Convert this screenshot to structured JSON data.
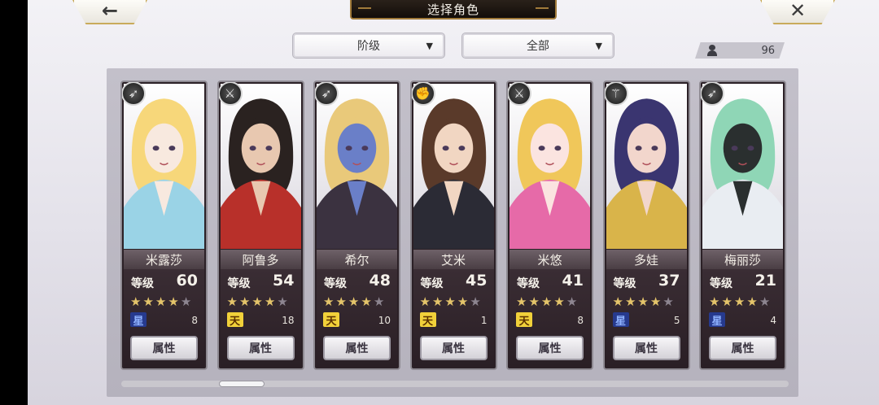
{
  "header": {
    "title": "选择角色",
    "back_icon": "back-arrow-icon",
    "close_icon": "close-x-icon"
  },
  "filters": {
    "rank": {
      "label": "阶级"
    },
    "category": {
      "label": "全部"
    }
  },
  "character_count": "96",
  "colors": {
    "gold_border": "#c9ab5b",
    "title_bg": "#1c1510",
    "star_on": "#e4c46a",
    "star_off": "#8d8590",
    "star_rank_badge": "#263a8e",
    "heaven_rank_badge": "#f1d13a"
  },
  "cards": [
    {
      "name": "米露莎",
      "level_label": "等级",
      "level": "60",
      "stars_on": 4,
      "stars_total": 5,
      "rank_icon": "星",
      "rank_type": "star",
      "sub_value": "8",
      "attr_label": "属性",
      "weapon_icon": "bow-icon",
      "palette": [
        "#f7d77a",
        "#9ad3e6",
        "#f8e9df"
      ]
    },
    {
      "name": "阿鲁多",
      "level_label": "等级",
      "level": "54",
      "stars_on": 4,
      "stars_total": 5,
      "rank_icon": "天",
      "rank_type": "heaven",
      "sub_value": "18",
      "attr_label": "属性",
      "weapon_icon": "sword-icon",
      "palette": [
        "#2a2220",
        "#b8302a",
        "#e8c8b0"
      ]
    },
    {
      "name": "希尔",
      "level_label": "等级",
      "level": "48",
      "stars_on": 4,
      "stars_total": 5,
      "rank_icon": "天",
      "rank_type": "heaven",
      "sub_value": "10",
      "attr_label": "属性",
      "weapon_icon": "bow-icon",
      "palette": [
        "#e9c97a",
        "#3b3240",
        "#6a7fc8"
      ]
    },
    {
      "name": "艾米",
      "level_label": "等级",
      "level": "45",
      "stars_on": 4,
      "stars_total": 5,
      "rank_icon": "天",
      "rank_type": "heaven",
      "sub_value": "1",
      "attr_label": "属性",
      "weapon_icon": "fist-icon",
      "palette": [
        "#5a3a2a",
        "#2b2b35",
        "#f1d6c2"
      ]
    },
    {
      "name": "米悠",
      "level_label": "等级",
      "level": "41",
      "stars_on": 4,
      "stars_total": 5,
      "rank_icon": "天",
      "rank_type": "heaven",
      "sub_value": "8",
      "attr_label": "属性",
      "weapon_icon": "sword-icon",
      "palette": [
        "#f0c75a",
        "#e66aa8",
        "#fbe4e0"
      ]
    },
    {
      "name": "多娃",
      "level_label": "等级",
      "level": "37",
      "stars_on": 4,
      "stars_total": 5,
      "rank_icon": "星",
      "rank_type": "star",
      "sub_value": "5",
      "attr_label": "属性",
      "weapon_icon": "staff-icon",
      "palette": [
        "#3a3570",
        "#d9b44a",
        "#f2d6cc"
      ]
    },
    {
      "name": "梅丽莎",
      "level_label": "等级",
      "level": "21",
      "stars_on": 4,
      "stars_total": 5,
      "rank_icon": "星",
      "rank_type": "star",
      "sub_value": "4",
      "attr_label": "属性",
      "weapon_icon": "bow-icon",
      "palette": [
        "#8fd6b6",
        "#e9edf2",
        "#2a2f2f"
      ]
    }
  ]
}
